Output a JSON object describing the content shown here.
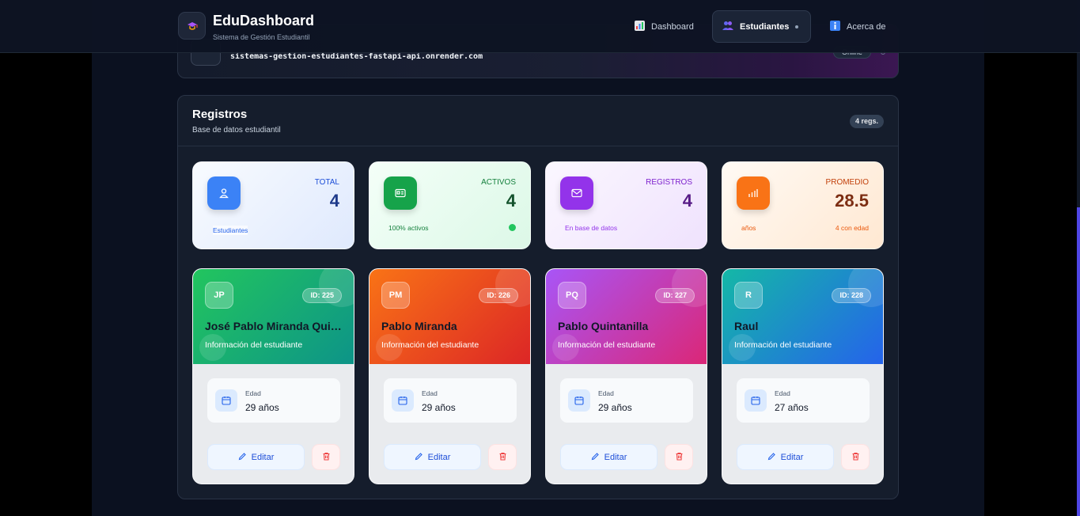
{
  "header": {
    "brand_title": "EduDashboard",
    "brand_subtitle": "Sistema de Gestión Estudiantil",
    "logo_icon": "graduation-cap-icon",
    "nav": [
      {
        "label": "Dashboard",
        "icon": "bar-chart-icon"
      },
      {
        "label": "Estudiantes",
        "icon": "users-icon"
      },
      {
        "label": "Acerca de",
        "icon": "info-icon"
      }
    ]
  },
  "api": {
    "url": "sistemas-gestion-estudiantes-fastapi-api.onrender.com",
    "status": "Online"
  },
  "registros": {
    "title": "Registros",
    "subtitle": "Base de datos estudiantil",
    "badge": "4 regs."
  },
  "stats": [
    {
      "label": "TOTAL",
      "value": "4",
      "footer": "Estudiantes",
      "icon": "user-icon",
      "color": "#3b82f6"
    },
    {
      "label": "ACTIVOS",
      "value": "4",
      "footer": "100% activos",
      "icon": "id-card-icon",
      "color": "#16a34a"
    },
    {
      "label": "REGISTROS",
      "value": "4",
      "footer": "En base de datos",
      "icon": "mail-icon",
      "color": "#9333ea"
    },
    {
      "label": "PROMEDIO",
      "value": "28.5",
      "footer": "años",
      "footer_right": "4 con edad",
      "icon": "bar-chart-icon",
      "color": "#f97316"
    }
  ],
  "students": [
    {
      "initials": "JP",
      "id": "ID: 225",
      "name": "José Pablo Miranda Quintanilla",
      "info": "Información del estudiante",
      "age_label": "Edad",
      "age": "29 años",
      "edit_label": "Editar"
    },
    {
      "initials": "PM",
      "id": "ID: 226",
      "name": "Pablo Miranda",
      "info": "Información del estudiante",
      "age_label": "Edad",
      "age": "29 años",
      "edit_label": "Editar"
    },
    {
      "initials": "PQ",
      "id": "ID: 227",
      "name": "Pablo Quintanilla",
      "info": "Información del estudiante",
      "age_label": "Edad",
      "age": "29 años",
      "edit_label": "Editar"
    },
    {
      "initials": "R",
      "id": "ID: 228",
      "name": "Raul",
      "info": "Información del estudiante",
      "age_label": "Edad",
      "age": "27 años",
      "edit_label": "Editar"
    }
  ]
}
